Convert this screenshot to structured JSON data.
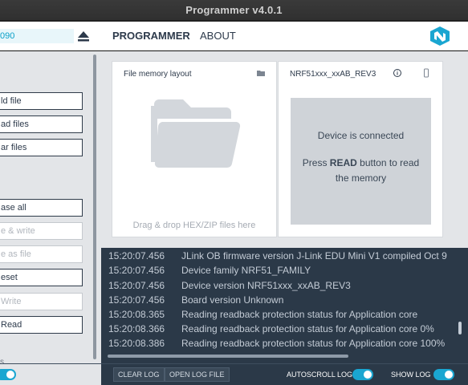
{
  "window": {
    "title": "Programmer v4.0.1"
  },
  "header": {
    "device_serial": "090",
    "nav": {
      "programmer": "PROGRAMMER",
      "about": "ABOUT"
    }
  },
  "sidebar": {
    "buttons": [
      {
        "label": "ld file",
        "enabled": true
      },
      {
        "label": "ad files",
        "enabled": true
      },
      {
        "label": "ar files",
        "enabled": true
      },
      {
        "label": "ase all",
        "enabled": true
      },
      {
        "label": "e & write",
        "enabled": false
      },
      {
        "label": "e as file",
        "enabled": false
      },
      {
        "label": "eset",
        "enabled": true
      },
      {
        "label": "Write",
        "enabled": false
      },
      {
        "label": "Read",
        "enabled": true
      }
    ],
    "tail_text": "s"
  },
  "file_card": {
    "title": "File memory layout",
    "hint": "Drag & drop HEX/ZIP files here"
  },
  "device_card": {
    "title": "NRF51xxx_xxAB_REV3",
    "status": "Device is connected",
    "hint_pre": "Press ",
    "hint_bold": "READ",
    "hint_post": " button to read the memory"
  },
  "log": {
    "entries": [
      {
        "time": "15:20:07.456",
        "message": "JLink OB firmware version J-Link EDU Mini V1 compiled Oct 9"
      },
      {
        "time": "15:20:07.456",
        "message": "Device family NRF51_FAMILY"
      },
      {
        "time": "15:20:07.456",
        "message": "Device version NRF51xxx_xxAB_REV3"
      },
      {
        "time": "15:20:07.456",
        "message": "Board version Unknown"
      },
      {
        "time": "15:20:08.365",
        "message": "Reading readback protection status for Application core"
      },
      {
        "time": "15:20:08.366",
        "message": "Reading readback protection status for Application core 0%"
      },
      {
        "time": "15:20:08.386",
        "message": "Reading readback protection status for Application core 100%"
      }
    ]
  },
  "bottom": {
    "clear_log": "CLEAR LOG",
    "open_log_file": "OPEN LOG FILE",
    "autoscroll_label": "AUTOSCROLL LOG",
    "show_log_label": "SHOW LOG",
    "autoscroll_on": true,
    "show_log_on": true
  },
  "colors": {
    "accent": "#1aa6d1",
    "log_bg": "#2b3948",
    "sidebar_bg": "#e3e5e8",
    "text_dark": "#2d3a4b"
  }
}
